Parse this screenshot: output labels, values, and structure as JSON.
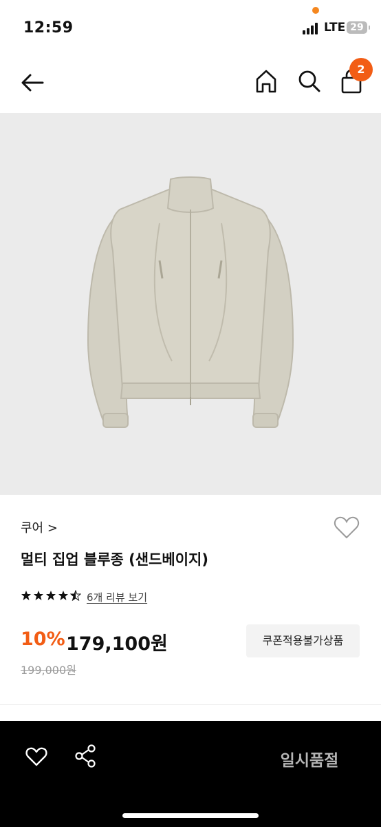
{
  "status": {
    "time": "12:59",
    "network": "LTE",
    "battery": "29"
  },
  "header": {
    "cart_count": "2"
  },
  "product": {
    "brand": "쿠어 >",
    "title": "멀티 집업 블루종 (샌드베이지)",
    "rating": 4.5,
    "reviews_label": "6개 리뷰 보기",
    "discount": "10%",
    "price": "179,100원",
    "original_price": "199,000원",
    "coupon_label": "쿠폰적용불가상품"
  },
  "bottom": {
    "soldout_label": "일시품절"
  },
  "colors": {
    "accent": "#f25d15",
    "image_bg": "#ebebeb",
    "jacket": "#d6d3c6"
  }
}
